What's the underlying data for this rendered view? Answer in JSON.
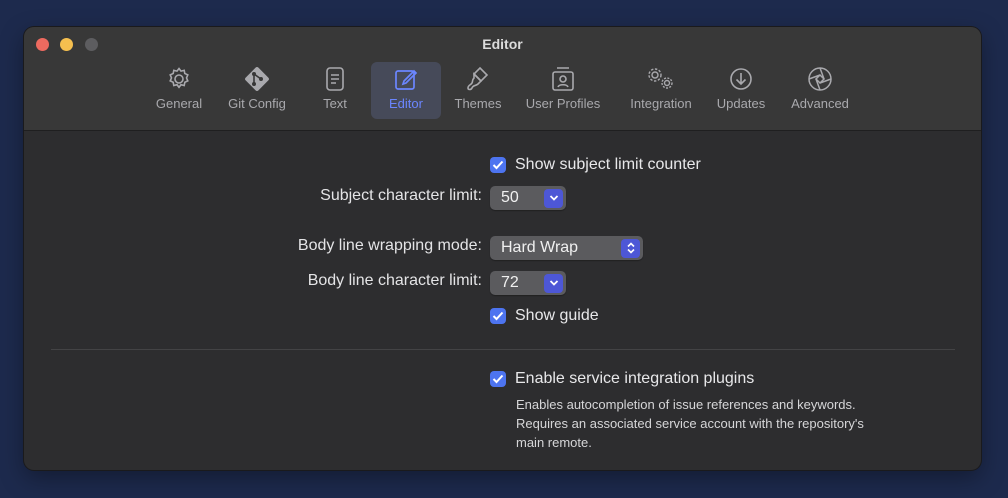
{
  "window": {
    "title": "Editor"
  },
  "toolbar": {
    "items": [
      {
        "label": "General",
        "icon": "gear-icon",
        "active": false
      },
      {
        "label": "Git Config",
        "icon": "git-icon",
        "active": false
      },
      {
        "label": "Text",
        "icon": "document-icon",
        "active": false
      },
      {
        "label": "Editor",
        "icon": "edit-icon",
        "active": true
      },
      {
        "label": "Themes",
        "icon": "paintbrush-icon",
        "active": false
      },
      {
        "label": "User Profiles",
        "icon": "user-profile-icon",
        "active": false
      },
      {
        "label": "Integration",
        "icon": "gears-icon",
        "active": false
      },
      {
        "label": "Updates",
        "icon": "download-icon",
        "active": false
      },
      {
        "label": "Advanced",
        "icon": "aperture-icon",
        "active": false
      }
    ]
  },
  "editor": {
    "show_subject_counter": {
      "label": "Show subject limit counter",
      "checked": true
    },
    "subject_limit": {
      "label": "Subject character limit:",
      "value": "50"
    },
    "wrap_mode": {
      "label": "Body line wrapping mode:",
      "value": "Hard Wrap"
    },
    "body_limit": {
      "label": "Body line character limit:",
      "value": "72"
    },
    "show_guide": {
      "label": "Show guide",
      "checked": true
    },
    "integration": {
      "label": "Enable service integration plugins",
      "checked": true,
      "description_lines": [
        "Enables autocompletion of issue references and keywords.",
        "Requires an associated service account with the repository's",
        "main remote."
      ]
    }
  },
  "colors": {
    "accent": "#4d74f0",
    "active_tab_text": "#6b86ff",
    "desktop": "#1d2a4d",
    "window_bg": "#2d2d2f"
  }
}
